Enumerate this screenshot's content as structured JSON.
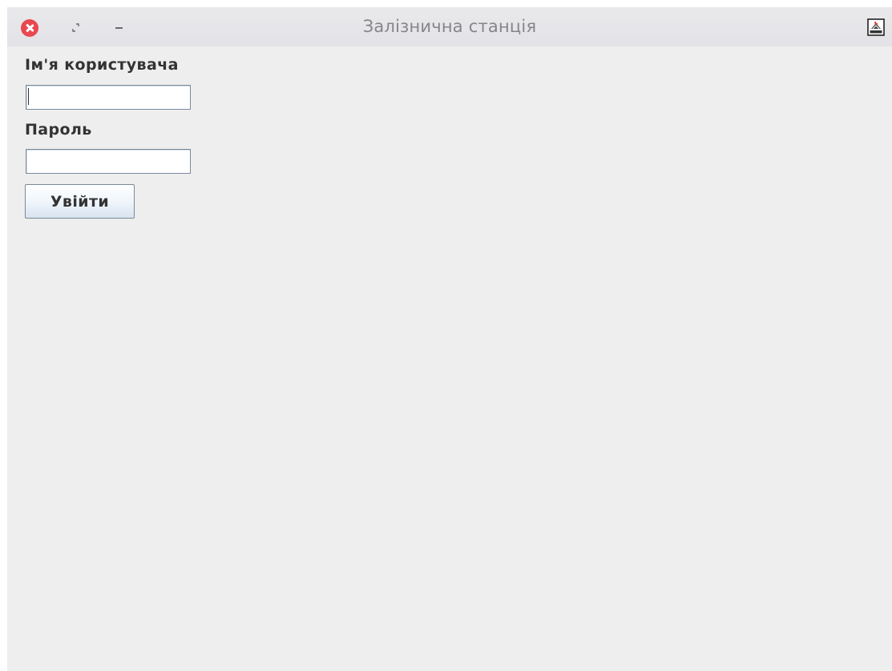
{
  "window": {
    "title": "Залізнична станція",
    "controls": {
      "close_icon": "close-icon",
      "restore_icon": "restore-icon",
      "minimize_icon": "minimize-icon",
      "app_icon": "java-app-icon"
    }
  },
  "login_form": {
    "username_label": "Ім'я користувача",
    "username_value": "",
    "password_label": "Пароль",
    "password_value": "",
    "submit_label": "Увійти"
  },
  "colors": {
    "window_background": "#eeeeee",
    "titlebar_background": "#e6e6e9",
    "close_button": "#e8484f",
    "title_text": "#86868a",
    "label_text": "#333333",
    "field_border": "#7a8a99"
  }
}
